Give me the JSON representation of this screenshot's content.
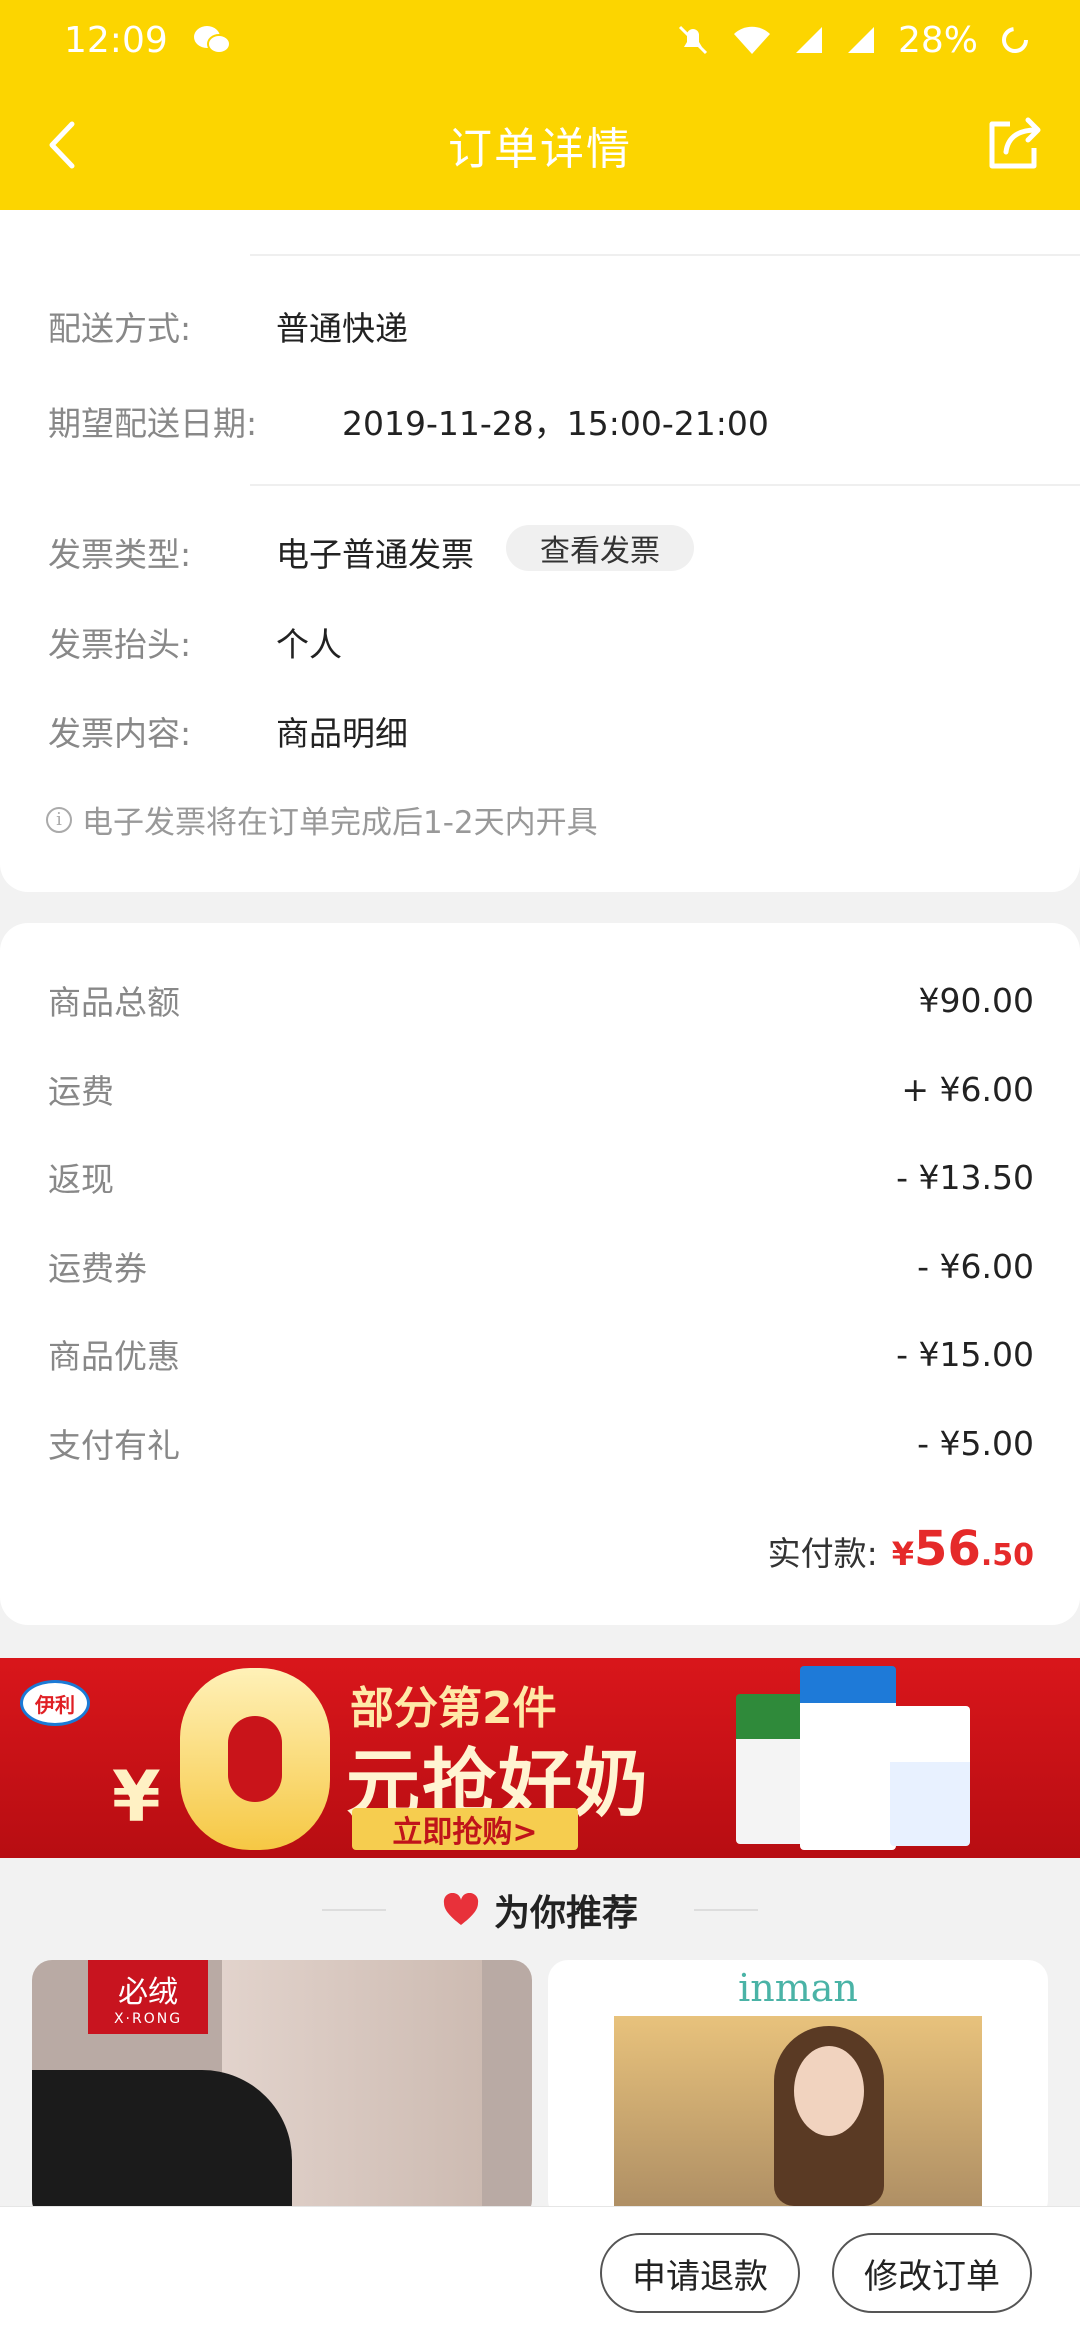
{
  "status_bar": {
    "time": "12:09",
    "battery": "28%"
  },
  "header": {
    "title": "订单详情"
  },
  "delivery": {
    "method_label": "配送方式:",
    "method_value": "普通快递",
    "date_label": "期望配送日期:",
    "date_value": "2019-11-28，15:00-21:00"
  },
  "invoice": {
    "type_label": "发票类型:",
    "type_value": "电子普通发票",
    "view_button": "查看发票",
    "title_label": "发票抬头:",
    "title_value": "个人",
    "content_label": "发票内容:",
    "content_value": "商品明细",
    "note": "电子发票将在订单完成后1-2天内开具"
  },
  "fees": [
    {
      "label": "商品总额",
      "value": "¥90.00"
    },
    {
      "label": "运费",
      "value": "+ ¥6.00"
    },
    {
      "label": "返现",
      "value": "- ¥13.50"
    },
    {
      "label": "运费券",
      "value": "- ¥6.00"
    },
    {
      "label": "商品优惠",
      "value": "- ¥15.00"
    },
    {
      "label": "支付有礼",
      "value": "- ¥5.00"
    }
  ],
  "paid": {
    "label": "实付款:",
    "currency": "¥",
    "integer": "56",
    "decimal": ".50"
  },
  "banner": {
    "logo": "伊利",
    "line1": "部分第2件",
    "line2": "元抢好奶",
    "yen": "¥",
    "cta": "立即抢购>"
  },
  "recommend": {
    "title": "为你推荐",
    "left_brand": "必绒",
    "left_brand_sub": "X·RONG",
    "right_brand": "inman"
  },
  "actions": {
    "refund": "申请退款",
    "modify": "修改订单"
  },
  "colors": {
    "brand_yellow": "#fcd500",
    "price_red": "#e52a2a"
  }
}
